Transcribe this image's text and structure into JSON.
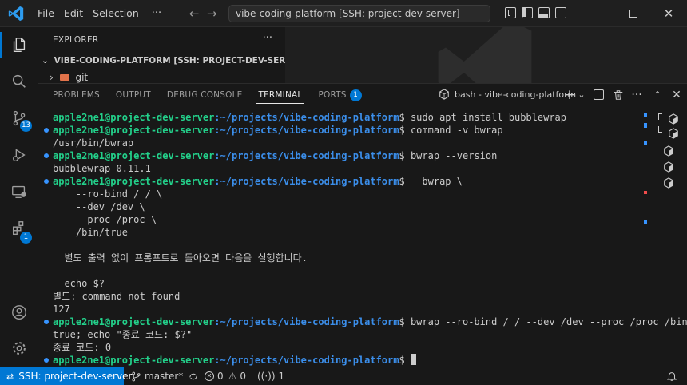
{
  "titlebar": {
    "menus": [
      "File",
      "Edit",
      "Selection"
    ],
    "more": "···",
    "command_center": "vibe-coding-platform [SSH: project-dev-server]"
  },
  "activity": {
    "source_control_badge": "13",
    "extensions_badge": "1"
  },
  "explorer": {
    "title": "EXPLORER",
    "more": "···",
    "root": "VIBE-CODING-PLATFORM [SSH: PROJECT-DEV-SERVER]",
    "file": "git"
  },
  "panel": {
    "tabs": [
      "PROBLEMS",
      "OUTPUT",
      "DEBUG CONSOLE",
      "TERMINAL",
      "PORTS"
    ],
    "ports_badge": "1",
    "terminal_name": "bash - vibe-coding-platform"
  },
  "terminal": {
    "user": "apple2ne1@project-dev-server",
    "path": ":~/projects/vibe-coding-platform",
    "lines": [
      {
        "type": "prompt",
        "cmd": " sudo apt install bubblewrap",
        "dot": false
      },
      {
        "type": "prompt",
        "cmd": " command -v bwrap",
        "dot": true
      },
      {
        "type": "out",
        "text": "/usr/bin/bwrap"
      },
      {
        "type": "prompt",
        "cmd": " bwrap --version",
        "dot": true
      },
      {
        "type": "out",
        "text": "bubblewrap 0.11.1"
      },
      {
        "type": "prompt",
        "cmd": "   bwrap \\",
        "dot": true
      },
      {
        "type": "out",
        "text": "    --ro-bind / / \\"
      },
      {
        "type": "out",
        "text": "    --dev /dev \\"
      },
      {
        "type": "out",
        "text": "    --proc /proc \\"
      },
      {
        "type": "out",
        "text": "    /bin/true"
      },
      {
        "type": "out",
        "text": ""
      },
      {
        "type": "out",
        "text": "  별도 출력 없이 프롬프트로 돌아오면 다음을 실행합니다."
      },
      {
        "type": "out",
        "text": ""
      },
      {
        "type": "out",
        "text": "  echo $?"
      },
      {
        "type": "out",
        "text": "별도: command not found"
      },
      {
        "type": "out",
        "text": "127"
      },
      {
        "type": "prompt",
        "cmd": " bwrap --ro-bind / / --dev /dev --proc /proc /bin/",
        "dot": true
      },
      {
        "type": "out",
        "text": "true; echo \"종료 코드: $?\""
      },
      {
        "type": "out",
        "text": "종료 코드: 0"
      },
      {
        "type": "prompt",
        "cmd": " ",
        "dot": true,
        "cursor": true
      }
    ]
  },
  "status": {
    "remote": "SSH: project-dev-server",
    "branch": "master*",
    "errors": "0",
    "warnings": "0",
    "ports": "1"
  },
  "colors": {
    "accent": "#0078d4",
    "user": "#23d18b",
    "path": "#3b8eea"
  }
}
